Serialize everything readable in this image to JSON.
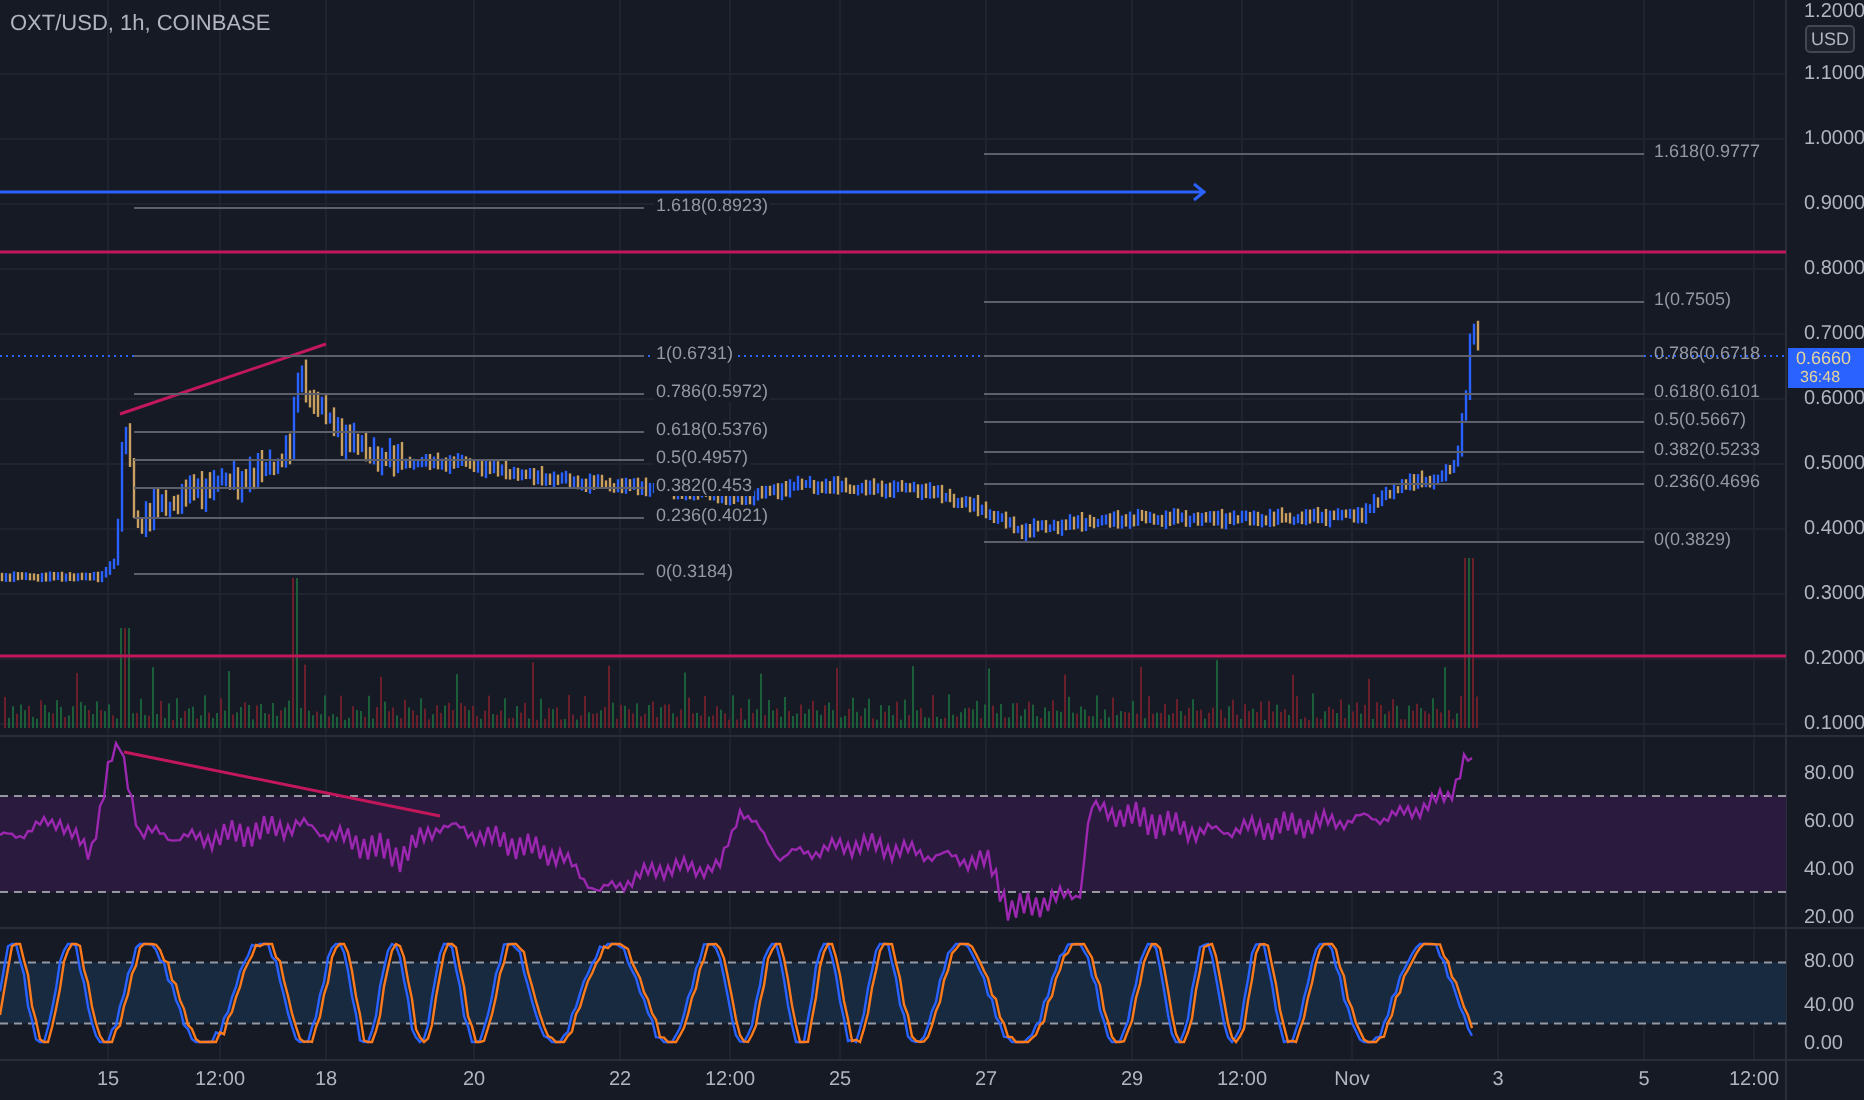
{
  "symbol_title": "OXT/USD, 1h, COINBASE",
  "price_axis": {
    "currency": "USD",
    "ticks": [
      "1.2000",
      "1.1000",
      "1.0000",
      "0.9000",
      "0.8000",
      "0.7000",
      "0.6000",
      "0.5000",
      "0.4000",
      "0.3000",
      "0.2000",
      "0.1000"
    ]
  },
  "last_price": {
    "value": "0.6660",
    "countdown": "36:48"
  },
  "fib_left": {
    "levels": [
      "1.618(0.8923)",
      "1(0.6731)",
      "0.786(0.5972)",
      "0.618(0.5376)",
      "0.5(0.4957)",
      "0.382(0.453",
      "0.236(0.4021)",
      "0(0.3184)"
    ]
  },
  "fib_right": {
    "levels": [
      "1.618(0.9777",
      "1(0.7505)",
      "0.786(0.6718",
      "0.618(0.6101",
      "0.5(0.5667)",
      "0.382(0.5233",
      "0.236(0.4696",
      "0(0.3829)"
    ]
  },
  "rsi_pane": {
    "ticks": [
      "80.00",
      "60.00",
      "40.00",
      "20.00"
    ]
  },
  "stoch_pane": {
    "ticks": [
      "80.00",
      "40.00",
      "0.00"
    ]
  },
  "time_axis": {
    "labels": [
      "15",
      "12:00",
      "18",
      "20",
      "22",
      "12:00",
      "25",
      "27",
      "29",
      "12:00",
      "Nov",
      "3",
      "5",
      "12:00"
    ]
  }
}
